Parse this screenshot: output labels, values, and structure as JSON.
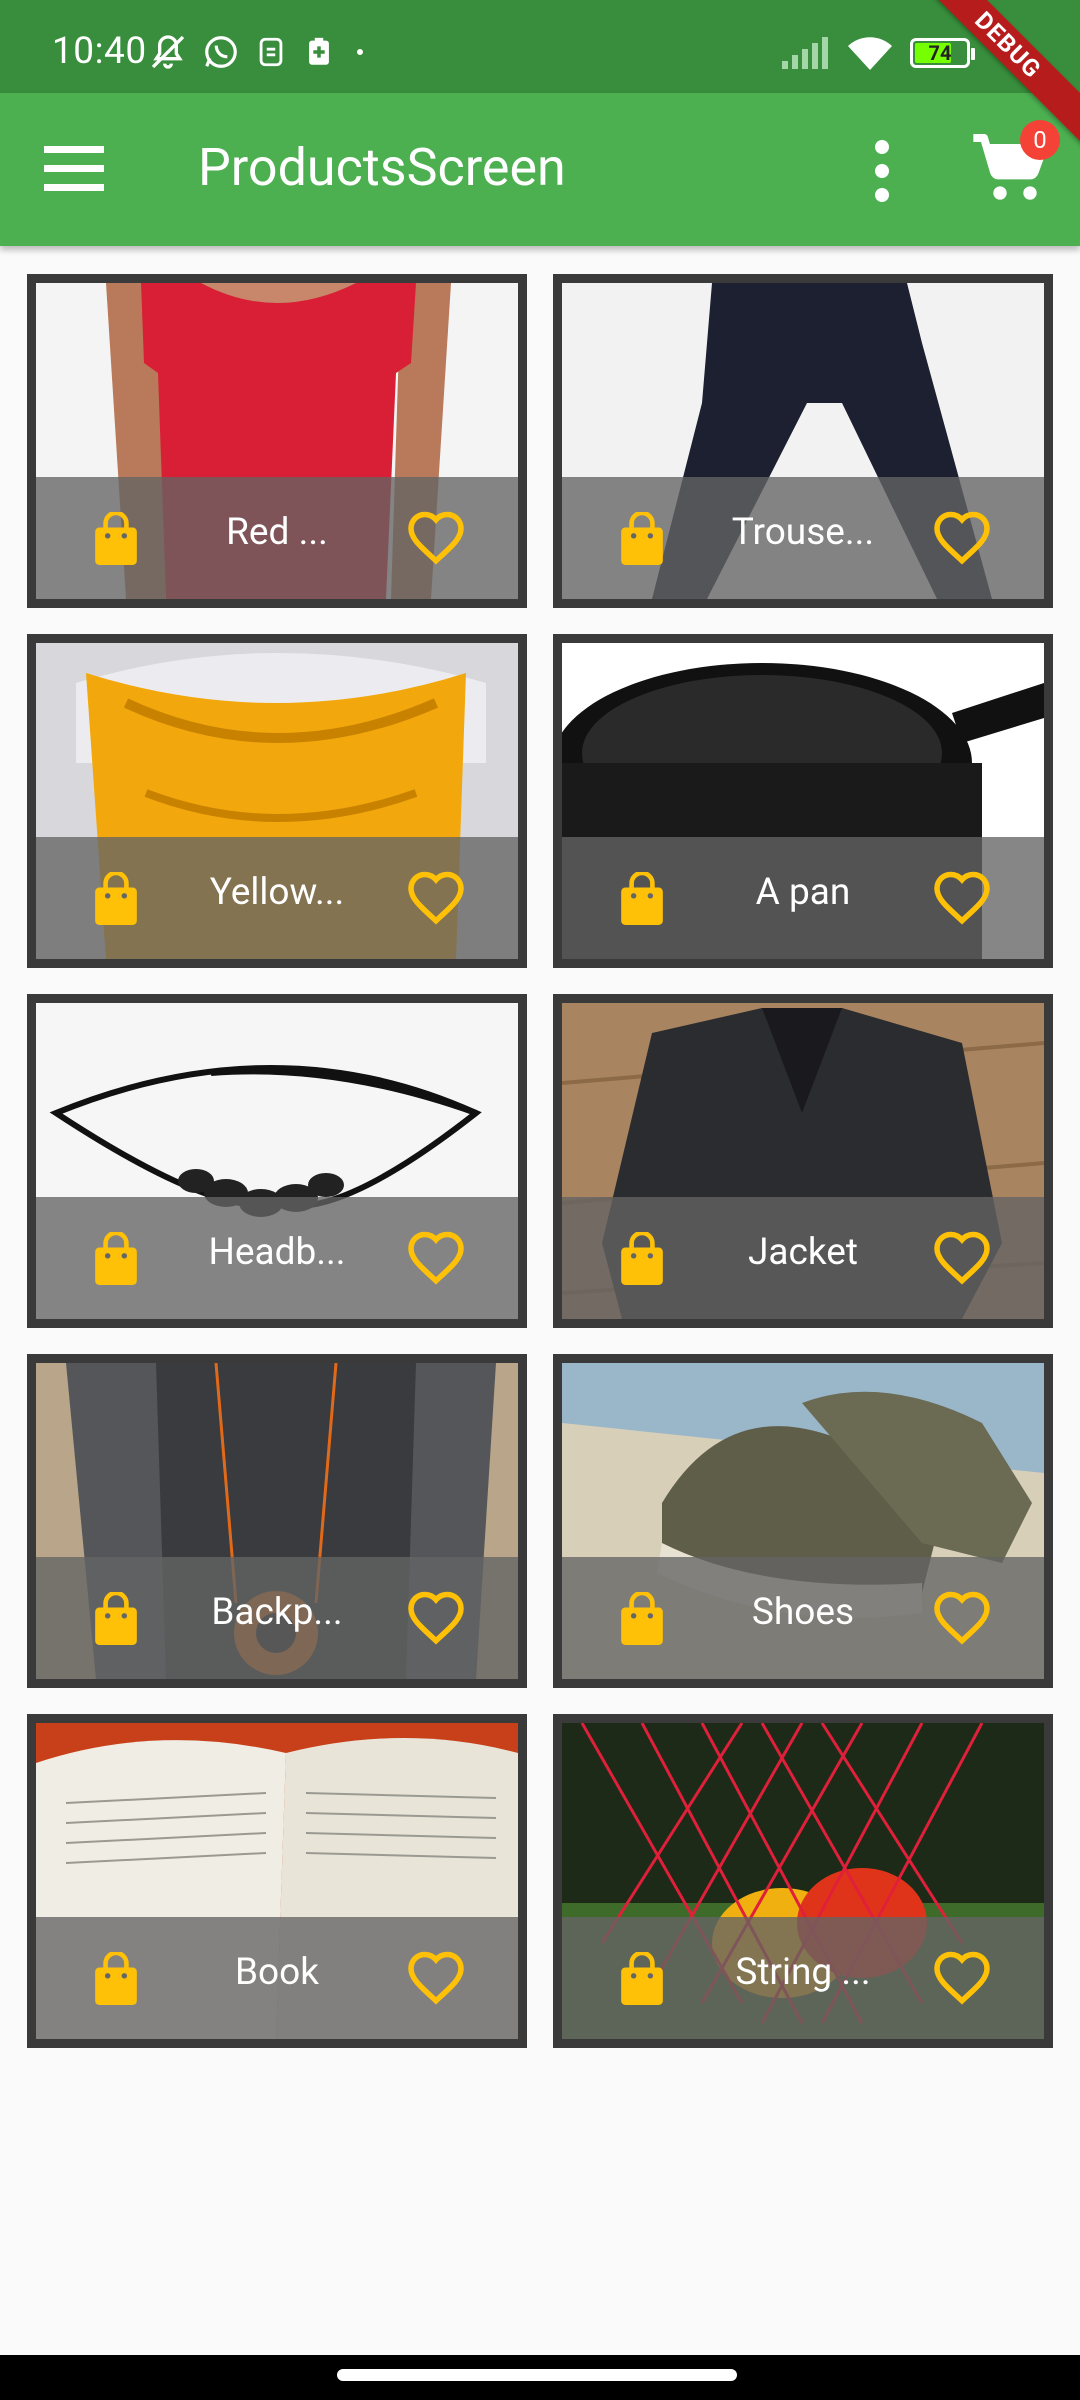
{
  "status_bar": {
    "time": "10:40",
    "battery_level": 74,
    "battery_label": "74"
  },
  "debug_banner": "DEBUG",
  "app_bar": {
    "title": "ProductsScreen",
    "cart_count": "0",
    "accent": "#4caf50",
    "status_color": "#388e3c"
  },
  "products": [
    {
      "title": "Red ...",
      "image": "red-shirt"
    },
    {
      "title": "Trouse...",
      "image": "trousers"
    },
    {
      "title": "Yellow...",
      "image": "yellow-scarf"
    },
    {
      "title": "A pan",
      "image": "pan"
    },
    {
      "title": "Headb...",
      "image": "headband"
    },
    {
      "title": "Jacket",
      "image": "jacket"
    },
    {
      "title": "Backp...",
      "image": "backpack"
    },
    {
      "title": "Shoes",
      "image": "shoes"
    },
    {
      "title": "Book",
      "image": "book"
    },
    {
      "title": "String ...",
      "image": "string-bag"
    }
  ],
  "icon_color": "#ffc107"
}
